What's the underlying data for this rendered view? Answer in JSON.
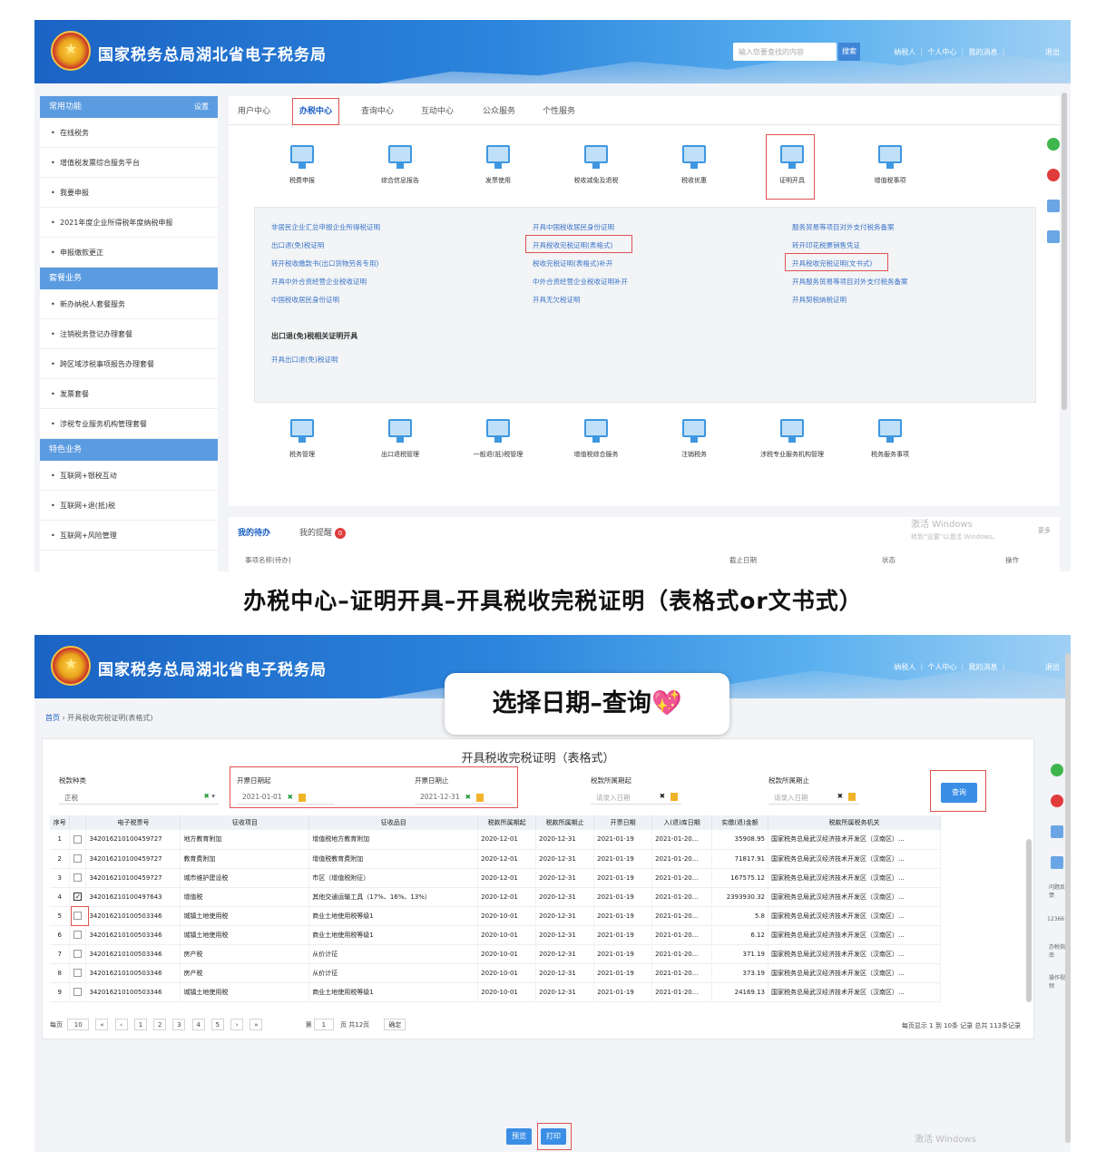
{
  "header": {
    "site_title": "国家税务总局湖北省电子税务局",
    "search_placeholder": "输入您要查找的内容",
    "search_btn": "搜索",
    "topnav": "纳税人 ｜ 个人中心 ｜ 我的消息 ｜",
    "logout": "退出"
  },
  "panel1": {
    "sidebar": {
      "sections": [
        {
          "title": "常用功能",
          "action": "设置",
          "items": [
            "在线税务",
            "增值税发票综合服务平台",
            "我要申报",
            "2021年度企业所得税年度纳税申报",
            "申报缴款更正"
          ]
        },
        {
          "title": "套餐业务",
          "items": [
            "新办纳税人套餐服务",
            "注销税务登记办理套餐",
            "跨区域涉税事项报告办理套餐",
            "发票套餐",
            "涉税专业服务机构管理套餐"
          ]
        },
        {
          "title": "特色业务",
          "items": [
            "互联网+银税互动",
            "互联网+退(抵)税",
            "互联网+风险管理"
          ]
        }
      ]
    },
    "tabs": [
      "用户中心",
      "办税中心",
      "查询中心",
      "互动中心",
      "公众服务",
      "个性服务"
    ],
    "icons_top": [
      "税费申报",
      "综合信息报告",
      "发票使用",
      "税收减免及退税",
      "税收优惠",
      "证明开具",
      "增值税事项"
    ],
    "links": {
      "col1": [
        "非居民企业汇总申报企业所得税证明",
        "出口退(免)税证明",
        "转开税收缴款书(出口货物劳务专用)",
        "开具中外合资经营企业税收证明",
        "中国税收居民身份证明"
      ],
      "col2": [
        "开具中国税收居民身份证明",
        "开具税收完税证明(表格式)",
        "税收完税证明(表格式)补开",
        "中外合资经营企业税收证明补开",
        "开具无欠税证明"
      ],
      "col3": [
        "服务贸易等项目对外支付税务备案",
        "转开印花税票销售凭证",
        "开具税收完税证明(文书式)",
        "开具服务贸易等项目对外支付税务备案",
        "开具契税纳税证明"
      ],
      "group_head": "出口退(免)税相关证明开具",
      "group_link": "开具出口退(免)税证明"
    },
    "icons_bottom": [
      "税务管理",
      "出口退税管理",
      "一般退(抵)税管理",
      "增值税综合服务",
      "注销税务",
      "涉税专业服务机构管理",
      "税务服务事项"
    ],
    "todo": {
      "tab_active": "我的待办",
      "tab_other": "我的提醒",
      "badge": "0",
      "col1": "事项名称(待办)",
      "col2": "截止日期",
      "col3": "状态",
      "col4": "操作",
      "more": "更多"
    }
  },
  "watermark": {
    "line1": "激活 Windows",
    "line2": "转到“设置”以激活 Windows。"
  },
  "caption": "办税中心–证明开具–开具税收完税证明（表格式or文书式）",
  "callout": {
    "text": "选择日期–查询",
    "emoji": "💖"
  },
  "panel2": {
    "breadcrumb": {
      "home": "首页",
      "sep": " › ",
      "current": "开具税收完税证明(表格式)"
    },
    "form_title": "开具税收完税证明（表格式）",
    "filters": {
      "tax_type_label": "税款种类",
      "tax_type_value": "正税",
      "date_from_label": "开票日期起",
      "date_from_value": "2021-01-01",
      "date_to_label": "开票日期止",
      "date_to_value": "2021-12-31",
      "period_from_label": "税款所属期起",
      "period_from_placeholder": "请录入日期",
      "period_to_label": "税款所属期止",
      "period_to_placeholder": "请录入日期",
      "query_btn": "查询"
    },
    "table": {
      "headers": [
        "序号",
        "",
        "电子税票号",
        "征收项目",
        "征收品目",
        "税款所属期起",
        "税款所属期止",
        "开票日期",
        "入(退)库日期",
        "实缴(退)金额",
        "税款所属税务机关"
      ],
      "rows": [
        [
          "1",
          "",
          "342016210100459727",
          "地方教育附加",
          "增值税地方教育附加",
          "2020-12-01",
          "2020-12-31",
          "2021-01-19",
          "2021-01-20...",
          "35908.95",
          "国家税务总局武汉经济技术开发区（汉南区）..."
        ],
        [
          "2",
          "",
          "342016210100459727",
          "教育费附加",
          "增值税教育费附加",
          "2020-12-01",
          "2020-12-31",
          "2021-01-19",
          "2021-01-20...",
          "71817.91",
          "国家税务总局武汉经济技术开发区（汉南区）..."
        ],
        [
          "3",
          "",
          "342016210100459727",
          "城市维护建设税",
          "市区（增值税附征）",
          "2020-12-01",
          "2020-12-31",
          "2021-01-19",
          "2021-01-20...",
          "167575.12",
          "国家税务总局武汉经济技术开发区（汉南区）..."
        ],
        [
          "4",
          "✓",
          "342016210100497643",
          "增值税",
          "其他交通运输工具（17%、16%、13%）",
          "2020-12-01",
          "2020-12-31",
          "2021-01-19",
          "2021-01-20...",
          "2393930.32",
          "国家税务总局武汉经济技术开发区（汉南区）..."
        ],
        [
          "5",
          "",
          "342016210100503346",
          "城镇土地使用税",
          "商业土地使用税等级1",
          "2020-10-01",
          "2020-12-31",
          "2021-01-19",
          "2021-01-20...",
          "5.8",
          "国家税务总局武汉经济技术开发区（汉南区）..."
        ],
        [
          "6",
          "",
          "342016210100503346",
          "城镇土地使用税",
          "商业土地使用税等级1",
          "2020-10-01",
          "2020-12-31",
          "2021-01-19",
          "2021-01-20...",
          "6.12",
          "国家税务总局武汉经济技术开发区（汉南区）..."
        ],
        [
          "7",
          "",
          "342016210100503346",
          "房产税",
          "从价计征",
          "2020-10-01",
          "2020-12-31",
          "2021-01-19",
          "2021-01-20...",
          "371.19",
          "国家税务总局武汉经济技术开发区（汉南区）..."
        ],
        [
          "8",
          "",
          "342016210100503346",
          "房产税",
          "从价计征",
          "2020-10-01",
          "2020-12-31",
          "2021-01-19",
          "2021-01-20...",
          "373.19",
          "国家税务总局武汉经济技术开发区（汉南区）..."
        ],
        [
          "9",
          "",
          "342016210100503346",
          "城镇土地使用税",
          "商业土地使用税等级1",
          "2020-10-01",
          "2020-12-31",
          "2021-01-19",
          "2021-01-20...",
          "24169.13",
          "国家税务总局武汉经济技术开发区（汉南区）..."
        ]
      ]
    },
    "pager": {
      "per_page_label": "每页",
      "per_page": "10",
      "pages": [
        "«",
        "‹",
        "1",
        "2",
        "3",
        "4",
        "5",
        "›",
        "»"
      ],
      "goto_prefix": "第",
      "goto_value": "1",
      "goto_suffix": "页 共12页",
      "goto_btn": "确定",
      "info": "每页显示 1 到 10条 记录 总共 113条记录"
    },
    "side_labels": [
      "问题反馈",
      "12366",
      "办税指南",
      "操作视频"
    ],
    "buttons": {
      "print_preview": "预览",
      "print": "打印"
    }
  },
  "colors": {
    "banner": "#2c85dc",
    "accent": "#3a8ee6",
    "highlight": "#e05252",
    "link": "#3a73c8"
  }
}
